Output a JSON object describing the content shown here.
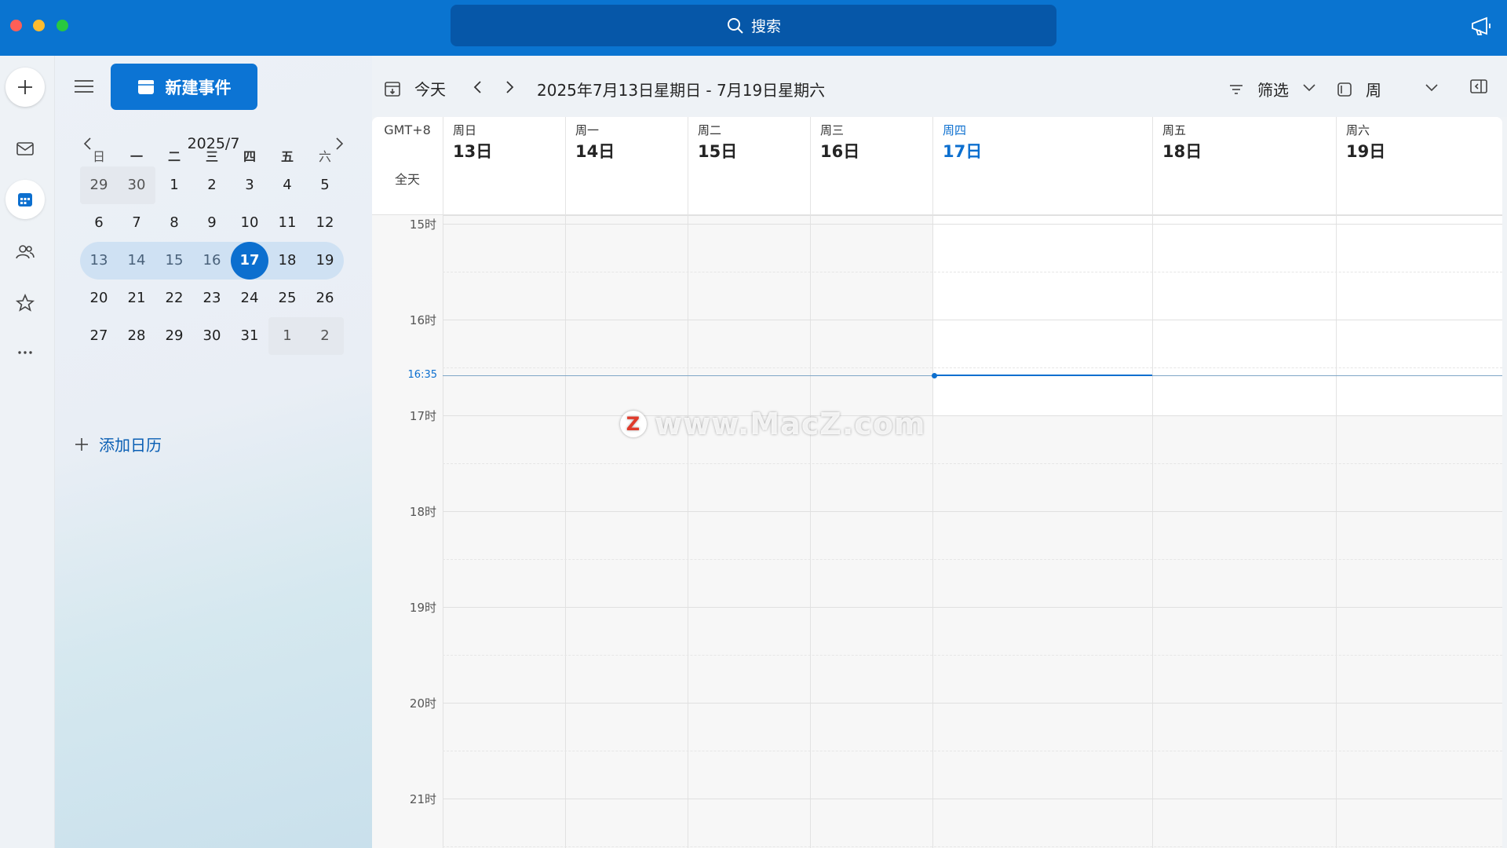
{
  "titlebar": {
    "search_label": "搜索",
    "colors": {
      "bar": "#0a74d0",
      "search": "#0657a8"
    }
  },
  "rail": {
    "items": [
      {
        "icon": "plus-icon"
      },
      {
        "icon": "mail-icon"
      },
      {
        "icon": "calendar-icon"
      },
      {
        "icon": "people-icon"
      },
      {
        "icon": "star-icon"
      },
      {
        "icon": "more-icon"
      }
    ]
  },
  "sidebar": {
    "new_event_label": "新建事件",
    "add_calendar_label": "添加日历"
  },
  "mini_calendar": {
    "title": "2025/7",
    "weekdays": [
      "日",
      "一",
      "二",
      "三",
      "四",
      "五",
      "六"
    ],
    "weeks": [
      [
        "29",
        "30",
        "1",
        "2",
        "3",
        "4",
        "5"
      ],
      [
        "6",
        "7",
        "8",
        "9",
        "10",
        "11",
        "12"
      ],
      [
        "13",
        "14",
        "15",
        "16",
        "17",
        "18",
        "19"
      ],
      [
        "20",
        "21",
        "22",
        "23",
        "24",
        "25",
        "26"
      ],
      [
        "27",
        "28",
        "29",
        "30",
        "31",
        "1",
        "2"
      ]
    ],
    "selected_week_index": 2,
    "today": "17"
  },
  "toolbar": {
    "today_label": "今天",
    "range_label": "2025年7月13日星期日 - 7月19日星期六",
    "filter_label": "筛选",
    "view_label": "周"
  },
  "week_view": {
    "timezone": "GMT+8",
    "all_day_label": "全天",
    "days": [
      {
        "weekday": "周日",
        "date": "13日"
      },
      {
        "weekday": "周一",
        "date": "14日"
      },
      {
        "weekday": "周二",
        "date": "15日"
      },
      {
        "weekday": "周三",
        "date": "16日"
      },
      {
        "weekday": "周四",
        "date": "17日"
      },
      {
        "weekday": "周五",
        "date": "18日"
      },
      {
        "weekday": "周六",
        "date": "19日"
      }
    ],
    "current_day_index": 4,
    "hours": [
      "15时",
      "16时",
      "17时",
      "18时",
      "19时",
      "20时",
      "21时"
    ],
    "current_time": "16:35"
  },
  "watermark": {
    "badge": "Z",
    "text": "www.MacZ.com"
  }
}
